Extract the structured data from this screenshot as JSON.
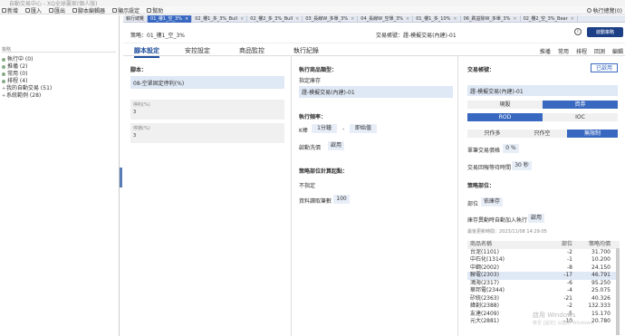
{
  "window": {
    "title": "自動交易中心 - XQ全球贏家(個人版)"
  },
  "toolbar": {
    "items": [
      "新增",
      "匯入",
      "匯出",
      "腳本編輯器",
      "顯示設定",
      "幫助"
    ],
    "right_label": "執行總覽(0)"
  },
  "sidebar": {
    "search_placeholder": "策略",
    "items": [
      {
        "label": "執行中 (0)",
        "sub": false
      },
      {
        "label": "推播 (2)",
        "sub": false
      },
      {
        "label": "常用 (0)",
        "sub": false
      },
      {
        "label": "排程 (4)",
        "sub": false
      },
      {
        "label": "我的自動交易 (51)",
        "sub": false
      },
      {
        "label": "系統範例 (28)",
        "sub": false
      }
    ]
  },
  "tabs": [
    {
      "label": "執行總覽",
      "active": false
    },
    {
      "label": "01_樓1_空_3%",
      "active": true
    },
    {
      "label": "02_樓1_多_3%_Bull",
      "active": false
    },
    {
      "label": "02_樓2_多_3%_Bull",
      "active": false
    },
    {
      "label": "03_長線W_多單_3%",
      "active": false
    },
    {
      "label": "04_長線W_空單_3%",
      "active": false
    },
    {
      "label": "01_樓1_多_10%",
      "active": false
    },
    {
      "label": "06_跌益除W_多單_3%",
      "active": false
    },
    {
      "label": "02_樓2_空_3%_Bear",
      "active": false
    }
  ],
  "header": {
    "strategy_name": "策略：01_樓1_空_3%",
    "account": "交易帳號：證-模擬交易(內建)-01",
    "info_icon": "i",
    "start_button": "啟動策略"
  },
  "subtabs": [
    "腳本設定",
    "安控設定",
    "商品監控",
    "執行紀錄"
  ],
  "actions": [
    "推播",
    "常用",
    "排程",
    "回測",
    "編輯"
  ],
  "script_panel": {
    "title": "腳本：",
    "script_name": "08-空單固定停利(%)",
    "params": [
      {
        "label": "停利(%)",
        "value": "3"
      },
      {
        "label": "停損(%)",
        "value": "3"
      }
    ]
  },
  "exec_panel": {
    "product_type_title": "執行商品類型：",
    "product_type_value": "指定庫存",
    "product_account": "證-模擬交易(內建)-01",
    "freq_title": "執行頻率：",
    "freq_label": "K棒",
    "freq_period": "1分鐘",
    "freq_dash": "-",
    "freq_mode": "即始值",
    "backfill_label": "啟用",
    "backfill_prefix": "啟動洗價",
    "position_title": "策略部位計算起點：",
    "position_value": "不指定",
    "data_label": "資料讀取筆數",
    "data_value": "100"
  },
  "trade_panel": {
    "title": "交易帳號：",
    "enable_button": "已啟用",
    "account": "證-模擬交易(內建)-01",
    "order_type": [
      "現股",
      "資券"
    ],
    "order_cond": [
      "ROD",
      "IOC"
    ],
    "order_side": [
      "只作多",
      "只作空",
      "無限制"
    ],
    "fee_label": "單筆交易價格",
    "fee_value": "0 %",
    "interval_label": "交易回報等待時間",
    "interval_value": "30 秒",
    "position_title": "策略部位：",
    "position_label": "部位",
    "position_value": "依庫存",
    "auto_label": "庫存異動時自動加入執行",
    "auto_value": "啟用",
    "updated": "最後更新時間：2023/11/08 14:29:05",
    "table_headers": [
      "商品名稱",
      "部位",
      "策略均價"
    ],
    "rows": [
      {
        "name": "台泥(1101)",
        "pos": "-2",
        "price": "31.700"
      },
      {
        "name": "中石化(1314)",
        "pos": "-1",
        "price": "10.200"
      },
      {
        "name": "中鋼(2002)",
        "pos": "-8",
        "price": "24.150"
      },
      {
        "name": "聯電(2303)",
        "pos": "-17",
        "price": "46.791"
      },
      {
        "name": "鴻海(2317)",
        "pos": "-6",
        "price": "95.250"
      },
      {
        "name": "華邦電(2344)",
        "pos": "-4",
        "price": "25.075"
      },
      {
        "name": "矽統(2363)",
        "pos": "-21",
        "price": "40.326"
      },
      {
        "name": "緯創(2388)",
        "pos": "-2",
        "price": "132.333"
      },
      {
        "name": "友達(2409)",
        "pos": "-5",
        "price": "15.170"
      },
      {
        "name": "元大(2881)",
        "pos": "-10",
        "price": "20.780"
      }
    ],
    "selected_row_index": 3
  },
  "watermark": {
    "line1": "啟用 Windows",
    "line2": "移至 [設定] 以啟用 Windows。"
  }
}
